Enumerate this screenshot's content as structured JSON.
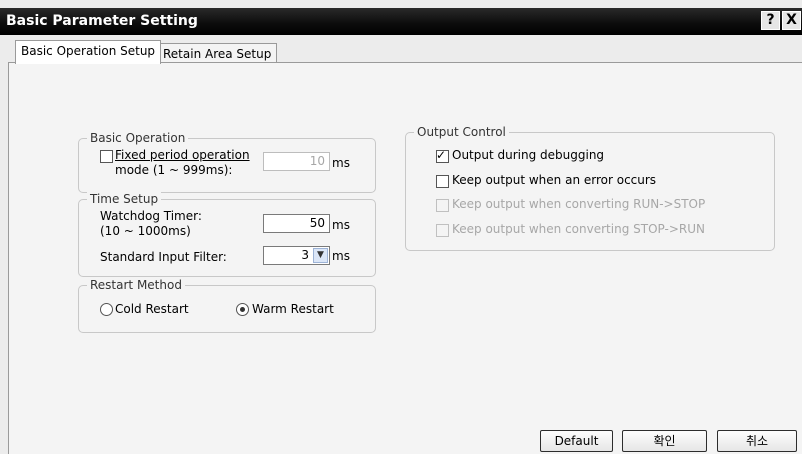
{
  "window": {
    "title": "Basic Parameter Setting",
    "help_glyph": "?",
    "close_glyph": "X"
  },
  "tabs": [
    "Basic Operation Setup",
    "Retain Area Setup"
  ],
  "basic_operation": {
    "legend": "Basic Operation",
    "fixed_period_label_line1": "Fixed period operation",
    "fixed_period_label_line2": "mode (1 ~ 999ms):",
    "fixed_period_checked": false,
    "fixed_period_value": "10",
    "unit": "ms"
  },
  "time_setup": {
    "legend": "Time Setup",
    "watchdog_label_line1": "Watchdog Timer:",
    "watchdog_label_line2": "(10 ~ 1000ms)",
    "watchdog_value": "50",
    "input_filter_label": "Standard Input Filter:",
    "input_filter_value": "3",
    "unit": "ms"
  },
  "restart_method": {
    "legend": "Restart Method",
    "cold_label": "Cold Restart",
    "warm_label": "Warm Restart",
    "selected": "warm"
  },
  "output_control": {
    "legend": "Output Control",
    "items": [
      {
        "label": "Output during debugging",
        "checked": true,
        "enabled": true
      },
      {
        "label": "Keep output when an error occurs",
        "checked": false,
        "enabled": true
      },
      {
        "label": "Keep output when converting RUN->STOP",
        "checked": false,
        "enabled": false
      },
      {
        "label": "Keep output when converting STOP->RUN",
        "checked": false,
        "enabled": false
      }
    ]
  },
  "buttons": {
    "default": "Default",
    "ok": "확인",
    "cancel": "취소"
  }
}
